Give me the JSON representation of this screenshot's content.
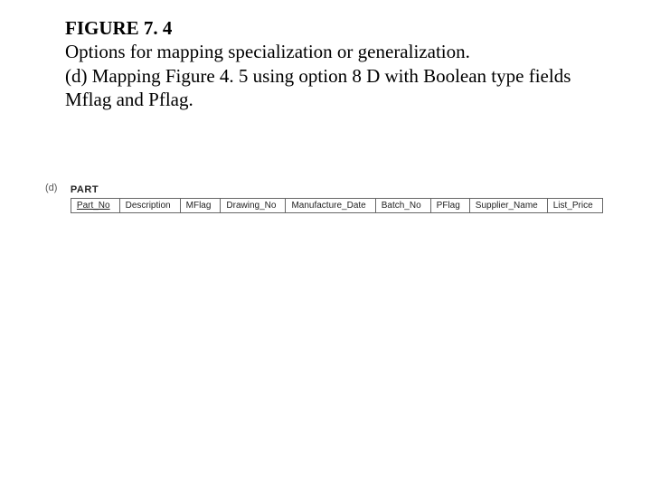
{
  "caption": {
    "figure_label": "FIGURE 7. 4",
    "line1": "Options for mapping specialization or generalization.",
    "line2": "(d) Mapping Figure 4. 5 using option 8 D with Boolean type fields Mflag and Pflag."
  },
  "diagram": {
    "sub_label": "(d)",
    "relation_name": "PART",
    "columns": [
      {
        "name": "Part_No",
        "pk": true
      },
      {
        "name": "Description",
        "pk": false
      },
      {
        "name": "MFlag",
        "pk": false
      },
      {
        "name": "Drawing_No",
        "pk": false
      },
      {
        "name": "Manufacture_Date",
        "pk": false
      },
      {
        "name": "Batch_No",
        "pk": false
      },
      {
        "name": "PFlag",
        "pk": false
      },
      {
        "name": "Supplier_Name",
        "pk": false
      },
      {
        "name": "List_Price",
        "pk": false
      }
    ]
  }
}
